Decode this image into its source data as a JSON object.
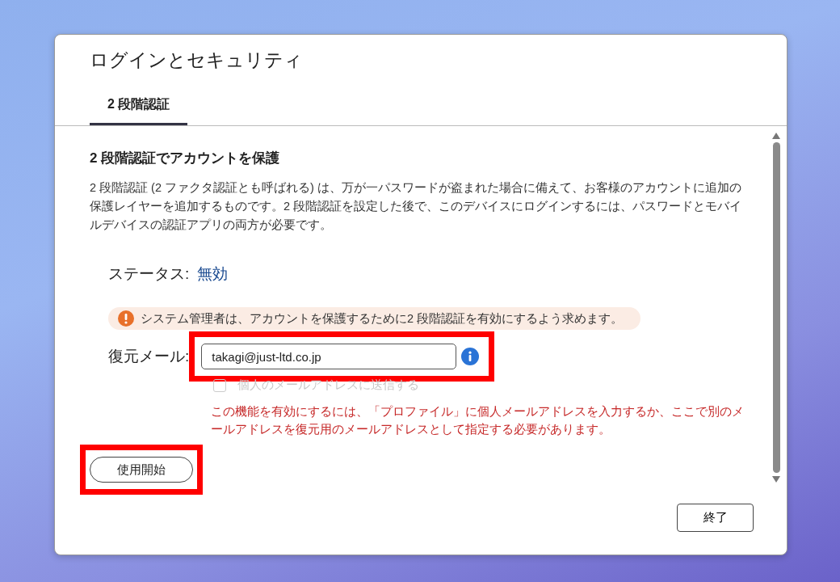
{
  "dialog": {
    "title": "ログインとセキュリティ",
    "tabs": [
      {
        "label": "2 段階認証",
        "selected": true
      }
    ],
    "section": {
      "heading": "2 段階認証でアカウントを保護",
      "description": "2 段階認証 (2 ファクタ認証とも呼ばれる) は、万が一パスワードが盗まれた場合に備えて、お客様のアカウントに追加の保護レイヤーを追加するものです。2 段階認証を設定した後で、このデバイスにログインするには、パスワードとモバイルデバイスの認証アプリの両方が必要です。",
      "status": {
        "label": "ステータス:",
        "value": "無効"
      },
      "warning": "システム管理者は、アカウントを保護するために2 段階認証を有効にするよう求めます。",
      "recovery_email": {
        "label": "復元メール:",
        "value": "takagi@just-ltd.co.jp",
        "highlighted": true
      },
      "personal_email_checkbox": {
        "label": "個人のメールアドレスに送信する",
        "checked": false,
        "disabled": true
      },
      "error": "この機能を有効にするには、「プロファイル」に個人メールアドレスを入力するか、ここで別のメールアドレスを復元用のメールアドレスとして指定する必要があります。",
      "start_button": {
        "label": "使用開始",
        "highlighted": true
      }
    },
    "buttons": [
      "終了"
    ]
  }
}
